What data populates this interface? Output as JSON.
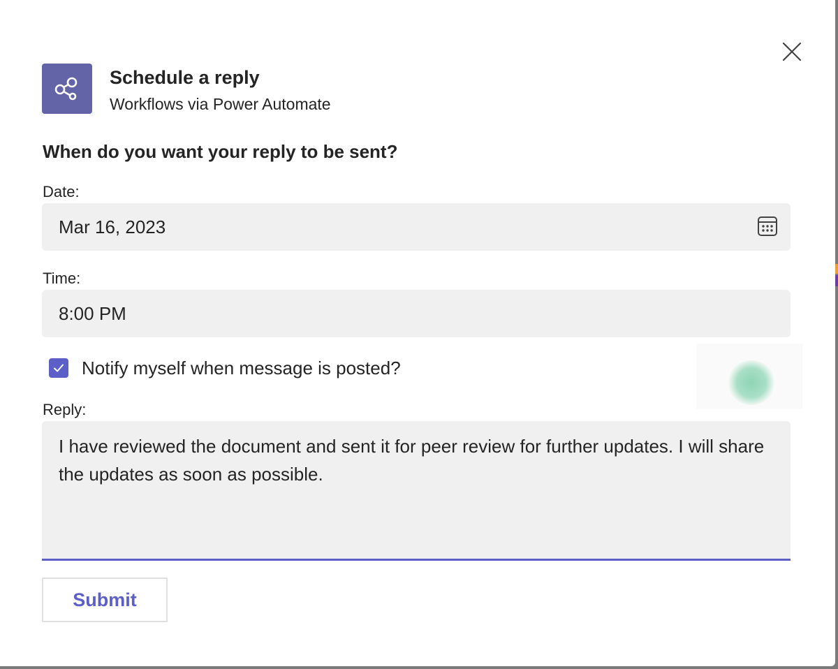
{
  "dialog": {
    "close_icon": "close-icon",
    "app": {
      "icon": "share-nodes-icon",
      "title": "Schedule a reply",
      "subtitle": "Workflows via Power Automate",
      "accent": "#6264a7"
    },
    "question": "When do you want your reply to be sent?",
    "date": {
      "label": "Date:",
      "value": "Mar 16, 2023",
      "icon": "calendar-icon"
    },
    "time": {
      "label": "Time:",
      "value": "8:00 PM"
    },
    "notify": {
      "checked": true,
      "label": "Notify myself when message is posted?"
    },
    "reply": {
      "label": "Reply:",
      "value": "I have reviewed the document and sent it for peer review for further updates. I will share the updates as soon as possible."
    },
    "submit_label": "Submit",
    "colors": {
      "brand": "#5b5fc7",
      "field_bg": "#f0f0f0"
    }
  }
}
